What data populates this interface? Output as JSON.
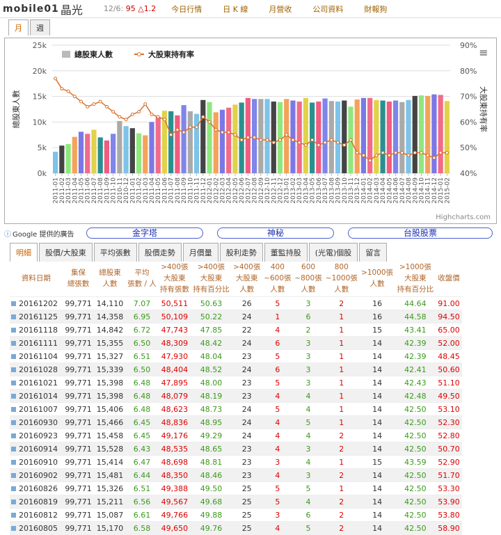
{
  "header": {
    "logo": "mobile01",
    "stock": "晶光",
    "quote_date": "12/6:",
    "quote_price": "95",
    "quote_change": "△1.2",
    "nav": [
      "今日行情",
      "日 K 線",
      "月營收",
      "公司資料",
      "財報狗"
    ]
  },
  "chart_tabs": [
    "月",
    "週"
  ],
  "chart_data": {
    "type": "bar",
    "legend": [
      "總股東人數",
      "大股東持有率"
    ],
    "ylabel": "總股東人數",
    "y2label": "大股東持有率",
    "yticks": [
      "25k",
      "20k",
      "15k",
      "10k",
      "5k",
      "0k"
    ],
    "y2ticks": [
      "90%",
      "80%",
      "70%",
      "60%",
      "50%",
      "40%"
    ],
    "ylim": [
      0,
      25000
    ],
    "y2lim": [
      40,
      90
    ],
    "series": [
      {
        "name": "總股東人數",
        "values": [
          4200,
          5400,
          5700,
          7100,
          8100,
          7700,
          8500,
          7000,
          6400,
          7700,
          10200,
          9200,
          8800,
          7800,
          7400,
          10000,
          11000,
          12200,
          12100,
          11300,
          13300,
          12100,
          11600,
          14300,
          13900,
          11900,
          12400,
          12800,
          13400,
          13800,
          14700,
          14500,
          14500,
          14500,
          14000,
          13900,
          14500,
          14200,
          14000,
          14700,
          13800,
          14000,
          14600,
          14100,
          14000,
          14200,
          13000,
          14400,
          14700,
          14700,
          14300,
          14200,
          14000,
          14200,
          13900,
          14300,
          15100,
          15200,
          15100,
          15400,
          15300,
          14100
        ]
      },
      {
        "name": "大股東持有率",
        "values": [
          77,
          73,
          72,
          70,
          68,
          66,
          67,
          68,
          66,
          64,
          62,
          61,
          63,
          64,
          67,
          63,
          62,
          61,
          55,
          57,
          56,
          58,
          58,
          62,
          60,
          57,
          56,
          56,
          55,
          53,
          54,
          54,
          53,
          53,
          52,
          53,
          55,
          53,
          52,
          51,
          53,
          51,
          52,
          53,
          52,
          51,
          53,
          48,
          47,
          45,
          47,
          48,
          47,
          48,
          48,
          47,
          48,
          48,
          47,
          46,
          48,
          48
        ]
      }
    ],
    "credit": "Highcharts.com"
  },
  "ads": {
    "google": "Google 提供的廣告",
    "links": [
      "金字塔",
      "神秘",
      "台股股票"
    ]
  },
  "tabs": [
    "明細",
    "股價/大股東",
    "平均張數",
    "股價走勢",
    "月價量",
    "股利走勢",
    "董監持股",
    "(光電)個股",
    "留言"
  ],
  "table": {
    "headers": [
      [
        "資料日期"
      ],
      [
        "集保",
        "總張數"
      ],
      [
        "總股東",
        "人數"
      ],
      [
        "平均",
        "張數 / 人"
      ],
      [
        ">400張",
        "大股東",
        "持有張數"
      ],
      [
        ">400張",
        "大股東",
        "持有百分比"
      ],
      [
        ">400張",
        "大股東",
        "人數"
      ],
      [
        "400",
        "~600張",
        "人數"
      ],
      [
        "600",
        "~800張",
        "人數"
      ],
      [
        "800",
        "~1000張",
        "人數"
      ],
      [
        ">1000張",
        "人數"
      ],
      [
        ">1000張",
        "大股東",
        "持有百分比"
      ],
      [
        "收盤價"
      ]
    ],
    "rows": [
      [
        "20161202",
        "99,771",
        "14,110",
        "7.07",
        "50,511",
        "50.63",
        "26",
        "5",
        "3",
        "2",
        "16",
        "44.64",
        "91.00"
      ],
      [
        "20161125",
        "99,771",
        "14,358",
        "6.95",
        "50,109",
        "50.22",
        "24",
        "1",
        "6",
        "1",
        "16",
        "44.58",
        "94.50"
      ],
      [
        "20161118",
        "99,771",
        "14,842",
        "6.72",
        "47,743",
        "47.85",
        "22",
        "4",
        "2",
        "1",
        "15",
        "43.41",
        "65.00"
      ],
      [
        "20161111",
        "99,771",
        "15,355",
        "6.50",
        "48,309",
        "48.42",
        "24",
        "6",
        "3",
        "1",
        "14",
        "42.39",
        "52.00"
      ],
      [
        "20161104",
        "99,771",
        "15,327",
        "6.51",
        "47,930",
        "48.04",
        "23",
        "5",
        "3",
        "1",
        "14",
        "42.39",
        "48.45"
      ],
      [
        "20161028",
        "99,771",
        "15,339",
        "6.50",
        "48,404",
        "48.52",
        "24",
        "6",
        "3",
        "1",
        "14",
        "42.41",
        "50.60"
      ],
      [
        "20161021",
        "99,771",
        "15,398",
        "6.48",
        "47,895",
        "48.00",
        "23",
        "5",
        "3",
        "1",
        "14",
        "42.43",
        "51.10"
      ],
      [
        "20161014",
        "99,771",
        "15,398",
        "6.48",
        "48,079",
        "48.19",
        "23",
        "4",
        "4",
        "1",
        "14",
        "42.48",
        "49.50"
      ],
      [
        "20161007",
        "99,771",
        "15,406",
        "6.48",
        "48,623",
        "48.73",
        "24",
        "5",
        "4",
        "1",
        "14",
        "42.50",
        "53.10"
      ],
      [
        "20160930",
        "99,771",
        "15,466",
        "6.45",
        "48,836",
        "48.95",
        "24",
        "4",
        "5",
        "1",
        "14",
        "42.50",
        "52.30"
      ],
      [
        "20160923",
        "99,771",
        "15,458",
        "6.45",
        "49,176",
        "49.29",
        "24",
        "4",
        "4",
        "2",
        "14",
        "42.50",
        "52.80"
      ],
      [
        "20160914",
        "99,771",
        "15,528",
        "6.43",
        "48,535",
        "48.65",
        "23",
        "4",
        "3",
        "2",
        "14",
        "42.50",
        "50.70"
      ],
      [
        "20160910",
        "99,771",
        "15,414",
        "6.47",
        "48,698",
        "48.81",
        "23",
        "3",
        "4",
        "1",
        "15",
        "43.59",
        "52.90"
      ],
      [
        "20160902",
        "99,771",
        "15,481",
        "6.44",
        "48,350",
        "48.46",
        "23",
        "4",
        "3",
        "2",
        "14",
        "42.50",
        "51.70"
      ],
      [
        "20160826",
        "99,771",
        "15,326",
        "6.51",
        "49,388",
        "49.50",
        "25",
        "5",
        "5",
        "1",
        "14",
        "42.50",
        "53.30"
      ],
      [
        "20160819",
        "99,771",
        "15,211",
        "6.56",
        "49,567",
        "49.68",
        "25",
        "5",
        "4",
        "2",
        "14",
        "42.50",
        "53.90"
      ],
      [
        "20160812",
        "99,771",
        "15,087",
        "6.61",
        "49,766",
        "49.88",
        "25",
        "3",
        "6",
        "2",
        "14",
        "42.50",
        "53.80"
      ],
      [
        "20160805",
        "99,771",
        "15,170",
        "6.58",
        "49,650",
        "49.76",
        "25",
        "4",
        "5",
        "2",
        "14",
        "42.50",
        "58.90"
      ]
    ]
  }
}
